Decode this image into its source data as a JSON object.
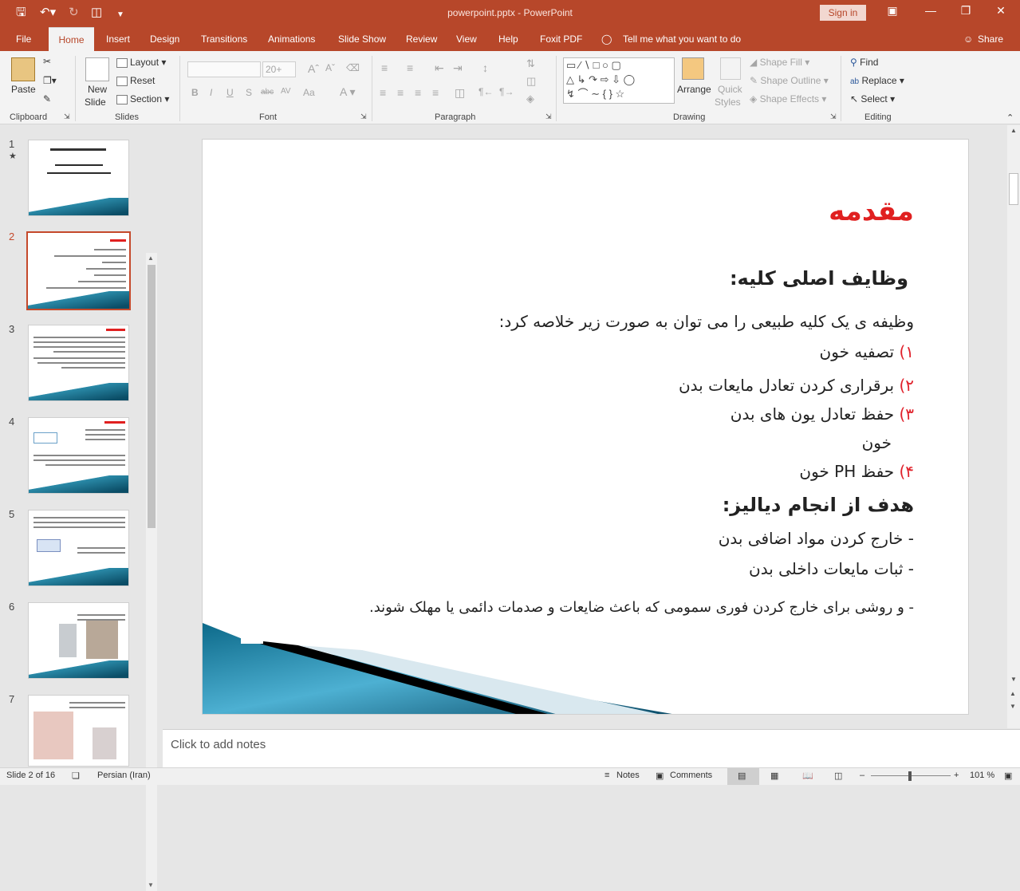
{
  "app": {
    "doc_title": "powerpoint.pptx  -  PowerPoint",
    "sign_in": "Sign in"
  },
  "tabs": {
    "file": "File",
    "home": "Home",
    "insert": "Insert",
    "design": "Design",
    "transitions": "Transitions",
    "animations": "Animations",
    "slide_show": "Slide Show",
    "review": "Review",
    "view": "View",
    "help": "Help",
    "foxit": "Foxit PDF",
    "tell_me": "Tell me what you want to do",
    "share": "Share"
  },
  "ribbon": {
    "clipboard": {
      "paste": "Paste",
      "label": "Clipboard"
    },
    "slides": {
      "new_slide_1": "New",
      "new_slide_2": "Slide",
      "layout": "Layout",
      "reset": "Reset",
      "section": "Section",
      "label": "Slides"
    },
    "font": {
      "font_size": "20+",
      "label": "Font"
    },
    "paragraph": {
      "label": "Paragraph"
    },
    "drawing": {
      "arrange": "Arrange",
      "quick_styles_1": "Quick",
      "quick_styles_2": "Styles",
      "shape_fill": "Shape Fill",
      "shape_outline": "Shape Outline",
      "shape_effects": "Shape Effects",
      "label": "Drawing"
    },
    "editing": {
      "find": "Find",
      "replace": "Replace",
      "select": "Select",
      "label": "Editing"
    }
  },
  "thumbnails": [
    {
      "num": "1"
    },
    {
      "num": "2"
    },
    {
      "num": "3"
    },
    {
      "num": "4"
    },
    {
      "num": "5"
    },
    {
      "num": "6"
    },
    {
      "num": "7"
    }
  ],
  "slide": {
    "title": "مقدمه",
    "heading1": "وظایف اصلی کلیه:",
    "intro": "وظیفه ی یک کلیه طبیعی را می توان به صورت زیر خلاصه کرد:",
    "items": [
      {
        "n": "۱)",
        "text": " تصفیه خون"
      },
      {
        "n": "۲)",
        "text": " برقراری کردن تعادل مایعات بدن"
      },
      {
        "n": "۳)",
        "text": " حفظ تعادل یون های بدن"
      }
    ],
    "item3_cont": "خون",
    "item4": {
      "n": "۴)",
      "text": " حفظ PH خون"
    },
    "heading2": "هدف از انجام دیالیز:",
    "bullets": [
      "- خارج کردن مواد اضافی بدن",
      "- ثبات مایعات داخلی بدن",
      "- و روشی برای خارج کردن فوری سمومی که باعث ضایعات و صدمات  دائمی یا مهلک  شوند."
    ]
  },
  "notes": {
    "placeholder": "Click to add notes"
  },
  "status": {
    "slide": "Slide 2 of 16",
    "language": "Persian (Iran)",
    "notes": "Notes",
    "comments": "Comments",
    "zoom": "101 %"
  }
}
